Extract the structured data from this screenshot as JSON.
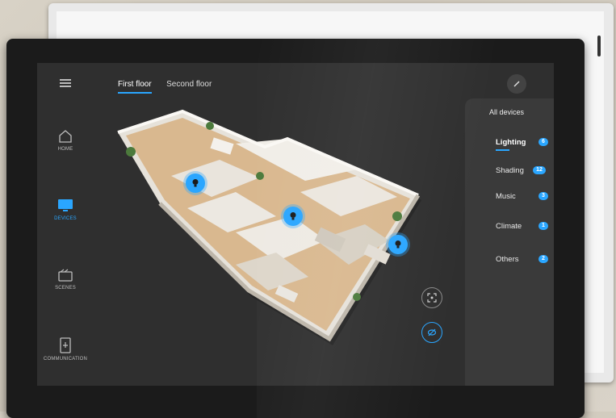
{
  "floors": {
    "tabs": [
      {
        "label": "First floor",
        "active": true
      },
      {
        "label": "Second floor",
        "active": false
      }
    ]
  },
  "sidebar": {
    "items": [
      {
        "label": "HOME",
        "icon": "home-icon"
      },
      {
        "label": "DEVICES",
        "icon": "monitor-icon",
        "active": true
      },
      {
        "label": "SCENES",
        "icon": "scenes-icon"
      },
      {
        "label": "COMMUNICATION",
        "icon": "door-phone-icon"
      }
    ]
  },
  "devices": {
    "all_label": "All devices",
    "categories": [
      {
        "label": "Lighting",
        "count": "6",
        "active": true
      },
      {
        "label": "Shading",
        "count": "12"
      },
      {
        "label": "Music",
        "count": "3"
      },
      {
        "label": "Climate",
        "count": "1"
      },
      {
        "label": "Others",
        "count": "2"
      }
    ]
  },
  "colors": {
    "accent": "#2aa6ff",
    "screen_bg": "#2f2f2f",
    "panel_bg": "#3a3a3a"
  }
}
